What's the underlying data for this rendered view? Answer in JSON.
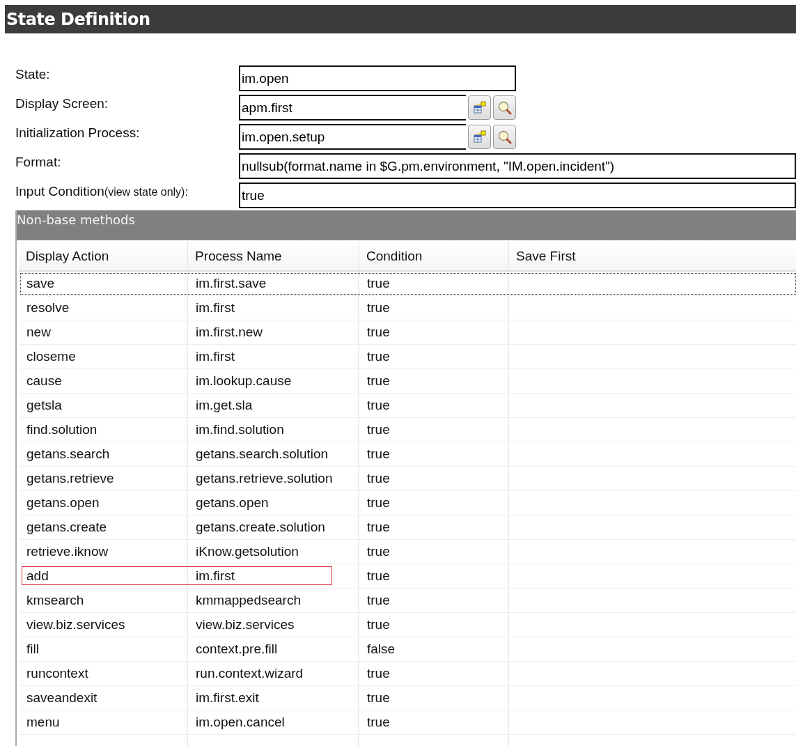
{
  "header": {
    "title": "State Definition"
  },
  "fields": [
    {
      "label": "State:",
      "value": "im.open",
      "kind": "short"
    },
    {
      "label": "Display Screen:",
      "value": "apm.first",
      "kind": "lookup"
    },
    {
      "label": "Initialization Process:",
      "value": "im.open.setup",
      "kind": "lookup"
    },
    {
      "label": "Format:",
      "value": "nullsub(format.name in $G.pm.environment, \"IM.open.incident\")",
      "kind": "wide"
    },
    {
      "label": "Input Condition",
      "note": "(view state only):",
      "value": "true",
      "kind": "wide"
    }
  ],
  "methods": {
    "title": "Non-base methods",
    "columns": [
      "Display Action",
      "Process Name",
      "Condition",
      "Save First"
    ],
    "rows": [
      {
        "cells": [
          "save",
          "im.first.save",
          "true"
        ],
        "focused": true,
        "highlighted": false
      },
      {
        "cells": [
          "resolve",
          "im.first",
          "true"
        ],
        "focused": false,
        "highlighted": false
      },
      {
        "cells": [
          "new",
          "im.first.new",
          "true"
        ],
        "focused": false,
        "highlighted": false
      },
      {
        "cells": [
          "closeme",
          "im.first",
          "true"
        ],
        "focused": false,
        "highlighted": false
      },
      {
        "cells": [
          "cause",
          "im.lookup.cause",
          "true"
        ],
        "focused": false,
        "highlighted": false
      },
      {
        "cells": [
          "getsla",
          "im.get.sla",
          "true"
        ],
        "focused": false,
        "highlighted": false
      },
      {
        "cells": [
          "find.solution",
          "im.find.solution",
          "true"
        ],
        "focused": false,
        "highlighted": false
      },
      {
        "cells": [
          "getans.search",
          "getans.search.solution",
          "true"
        ],
        "focused": false,
        "highlighted": false
      },
      {
        "cells": [
          "getans.retrieve",
          "getans.retrieve.solution",
          "true"
        ],
        "focused": false,
        "highlighted": false
      },
      {
        "cells": [
          "getans.open",
          "getans.open",
          "true"
        ],
        "focused": false,
        "highlighted": false
      },
      {
        "cells": [
          "getans.create",
          "getans.create.solution",
          "true"
        ],
        "focused": false,
        "highlighted": false
      },
      {
        "cells": [
          "retrieve.iknow",
          "iKnow.getsolution",
          "true"
        ],
        "focused": false,
        "highlighted": false
      },
      {
        "cells": [
          "add",
          "im.first",
          "true"
        ],
        "focused": false,
        "highlighted": true
      },
      {
        "cells": [
          "kmsearch",
          "kmmappedsearch",
          "true"
        ],
        "focused": false,
        "highlighted": false
      },
      {
        "cells": [
          "view.biz.services",
          "view.biz.services",
          "true"
        ],
        "focused": false,
        "highlighted": false
      },
      {
        "cells": [
          "fill",
          "context.pre.fill",
          "false"
        ],
        "focused": false,
        "highlighted": false
      },
      {
        "cells": [
          "runcontext",
          "run.context.wizard",
          "true"
        ],
        "focused": false,
        "highlighted": false
      },
      {
        "cells": [
          "saveandexit",
          "im.first.exit",
          "true"
        ],
        "focused": false,
        "highlighted": false
      },
      {
        "cells": [
          "menu",
          "im.open.cancel",
          "true"
        ],
        "focused": false,
        "highlighted": false
      }
    ]
  }
}
